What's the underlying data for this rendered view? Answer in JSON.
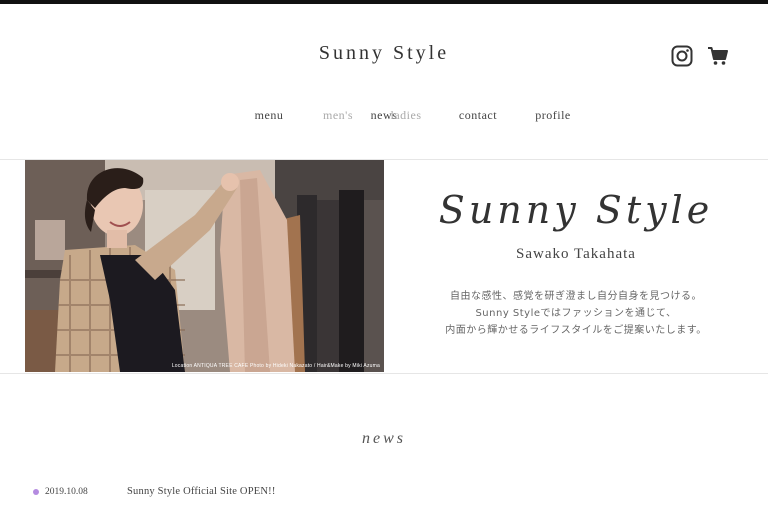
{
  "site": {
    "logo": "Sunny Style"
  },
  "icons": {
    "instagram": "instagram-icon",
    "cart": "cart-icon"
  },
  "nav": {
    "items": [
      {
        "label": "news",
        "state": "normal"
      },
      {
        "label": "menu",
        "state": "normal"
      },
      {
        "label": "men's",
        "state": "muted"
      },
      {
        "label": "ladies",
        "state": "muted"
      },
      {
        "label": "contact",
        "state": "normal"
      },
      {
        "label": "profile",
        "state": "normal"
      }
    ]
  },
  "hero": {
    "photo_credit": "Location  ANTIQUA TREE CAFE   Photo by Hideki Nakazato / Hair&Make by Miki Azuma",
    "title": "Sunny Style",
    "subtitle": "Sawako Takahata",
    "description": [
      "自由な感性、感覚を研ぎ澄まし自分自身を見つける。",
      "Sunny Styleではファッションを通じて、",
      "内面から輝かせるライフスタイルをご提案いたします。"
    ]
  },
  "news": {
    "heading": "news",
    "items": [
      {
        "date": "2019.10.08",
        "text": "Sunny Style Official Site OPEN!!"
      }
    ]
  },
  "colors": {
    "accent_dot": "#b48be0",
    "muted_nav": "#aaaaaa",
    "text": "#333333"
  }
}
